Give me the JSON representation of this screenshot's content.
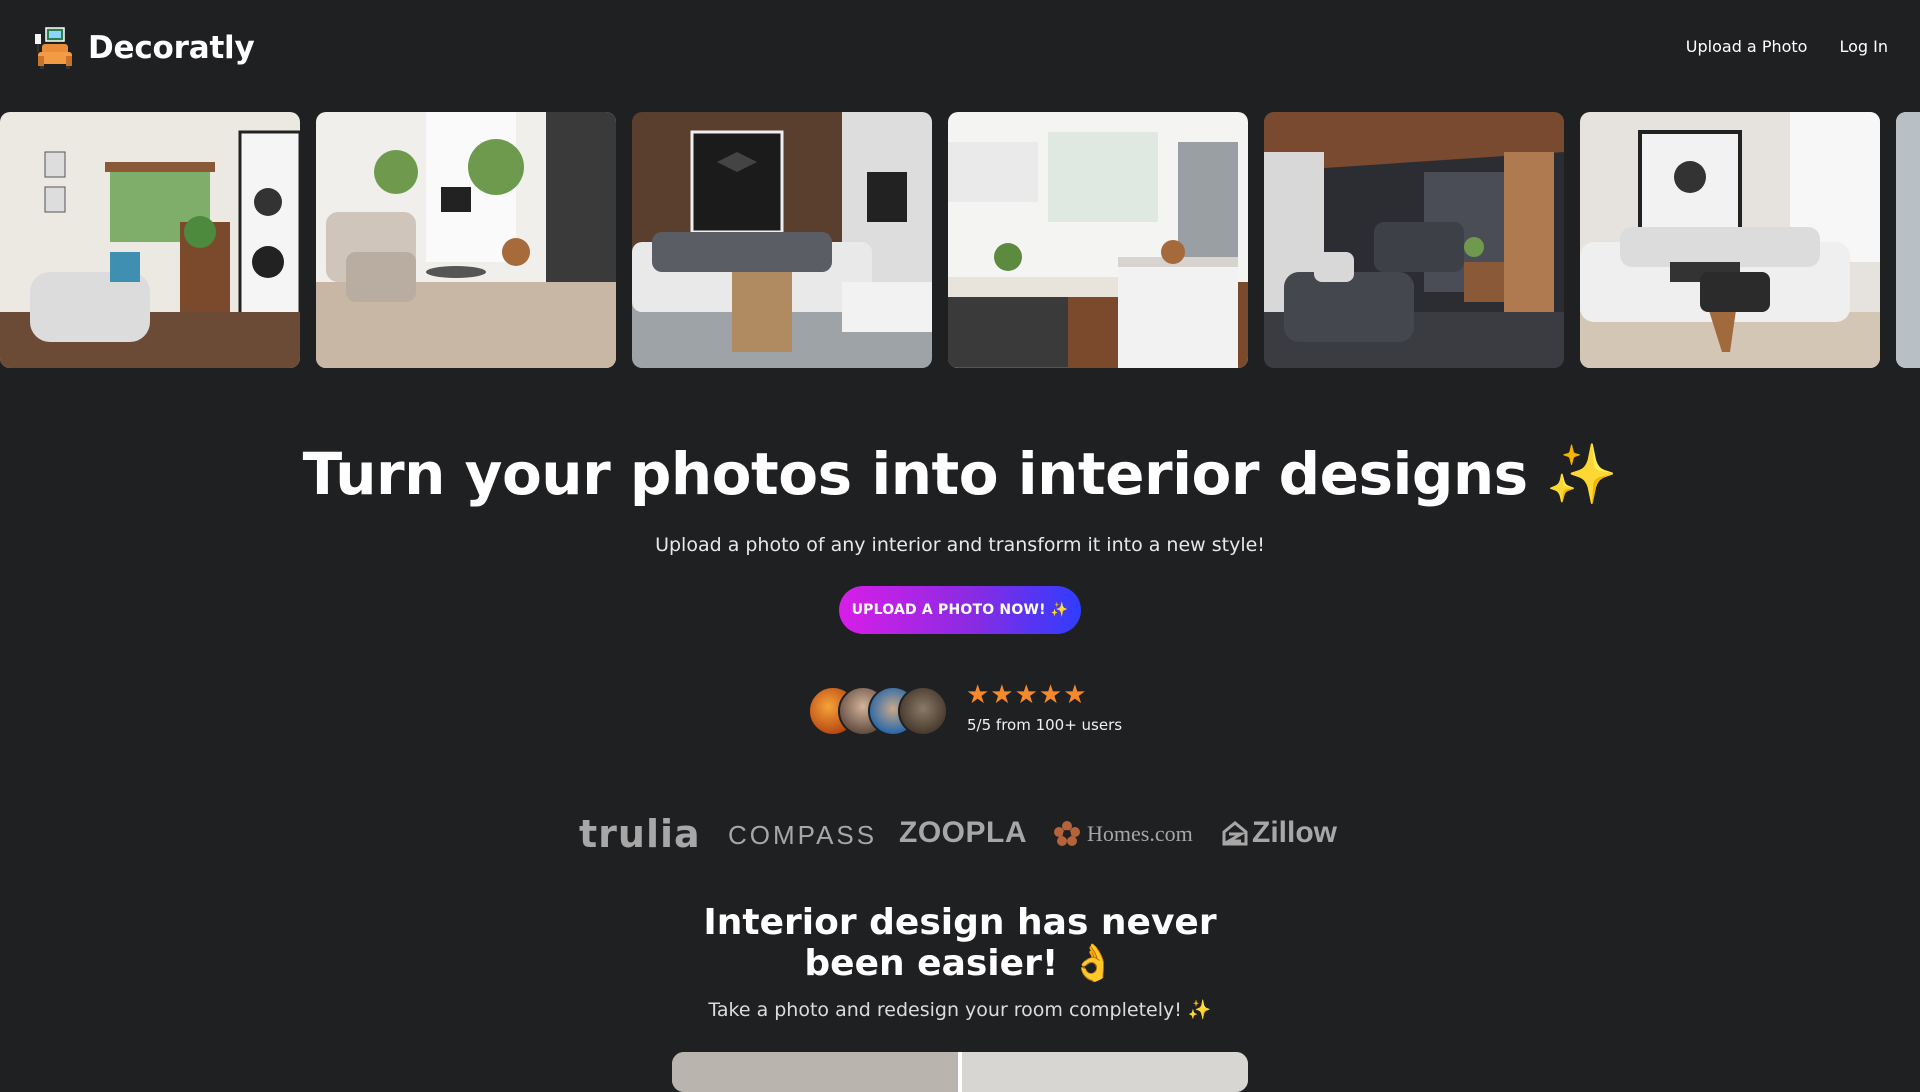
{
  "brand": {
    "name": "Decoratly",
    "logo_icon": "armchair-logo-icon"
  },
  "nav": {
    "upload": "Upload a Photo",
    "login": "Log In"
  },
  "hero": {
    "title": "Turn your photos into interior designs",
    "sparkle": "✨",
    "subtitle": "Upload a photo of any interior and transform it into a new style!",
    "cta": "UPLOAD A PHOTO NOW! ✨"
  },
  "social_proof": {
    "stars": "★★★★★",
    "rating_text": "5/5 from 100+ users",
    "star_color": "#f58a2d"
  },
  "brands": {
    "trulia": "trulia",
    "compass": "COMPASS",
    "zoopla": "ZOOPLA",
    "homes": "Homes.com",
    "zillow": "Zillow"
  },
  "section2": {
    "title": "Interior design has never been easier! 👌",
    "subtitle": "Take a photo and redesign your room completely!",
    "sparkle": "✨"
  },
  "colors": {
    "background": "#1f2022",
    "cta_gradient_start": "#d81ee8",
    "cta_gradient_end": "#2f3dff",
    "brand_logo_gray": "#a7a7a7",
    "sparkle_yellow": "#f7c934"
  }
}
